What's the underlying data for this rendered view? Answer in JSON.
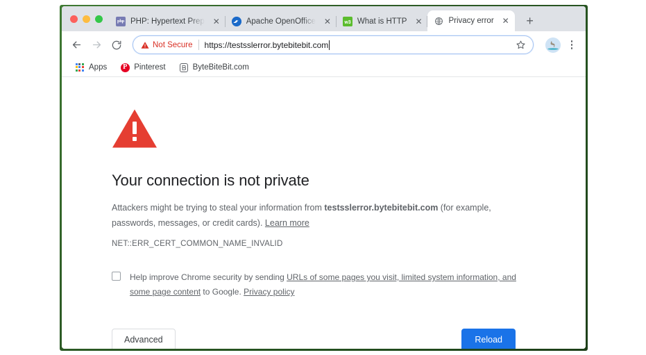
{
  "window": {
    "traffic_lights": [
      "close",
      "minimize",
      "maximize"
    ]
  },
  "tabs": [
    {
      "title": "PHP: Hypertext Prep",
      "favicon": "php-favicon",
      "active": false,
      "close_label": "✕"
    },
    {
      "title": "Apache OpenOffice",
      "favicon": "openoffice-favicon",
      "active": false,
      "close_label": "✕"
    },
    {
      "title": "What is HTTP",
      "favicon": "w3schools-favicon",
      "active": false,
      "close_label": "✕"
    },
    {
      "title": "Privacy error",
      "favicon": "globe-favicon",
      "active": true,
      "close_label": "✕"
    }
  ],
  "newtab": {
    "label": "+"
  },
  "toolbar": {
    "back_icon": "back-arrow-icon",
    "forward_icon": "forward-arrow-icon",
    "reload_icon": "reload-icon",
    "security_label": "Not Secure",
    "security_color": "#d93025",
    "url": "https://testsslerror.bytebitebit.com",
    "bookmark_icon": "star-icon",
    "profile_icon": "avatar",
    "menu_icon": "three-dot-menu-icon"
  },
  "bookmarks": [
    {
      "label": "Apps",
      "icon": "apps-grid-icon"
    },
    {
      "label": "Pinterest",
      "icon": "pinterest-icon"
    },
    {
      "label": "ByteBiteBit.com",
      "icon": "bytebitebit-icon"
    }
  ],
  "page": {
    "warning_icon": "red-warning-triangle-icon",
    "warning_color": "#e53e32",
    "headline": "Your connection is not private",
    "body_part1": "Attackers might be trying to steal your information from ",
    "body_domain": "testsslerror.bytebitebit.com",
    "body_part2": " (for example, passwords, messages, or credit cards). ",
    "learn_more": "Learn more",
    "error_code": "NET::ERR_CERT_COMMON_NAME_INVALID",
    "optin_part1": "Help improve Chrome security by sending ",
    "optin_link1": "URLs of some pages you visit, limited system information, and some page content",
    "optin_part2": " to Google. ",
    "optin_link2": "Privacy policy",
    "checkbox_checked": false,
    "advanced_label": "Advanced",
    "reload_label": "Reload",
    "reload_color": "#1a73e8"
  }
}
